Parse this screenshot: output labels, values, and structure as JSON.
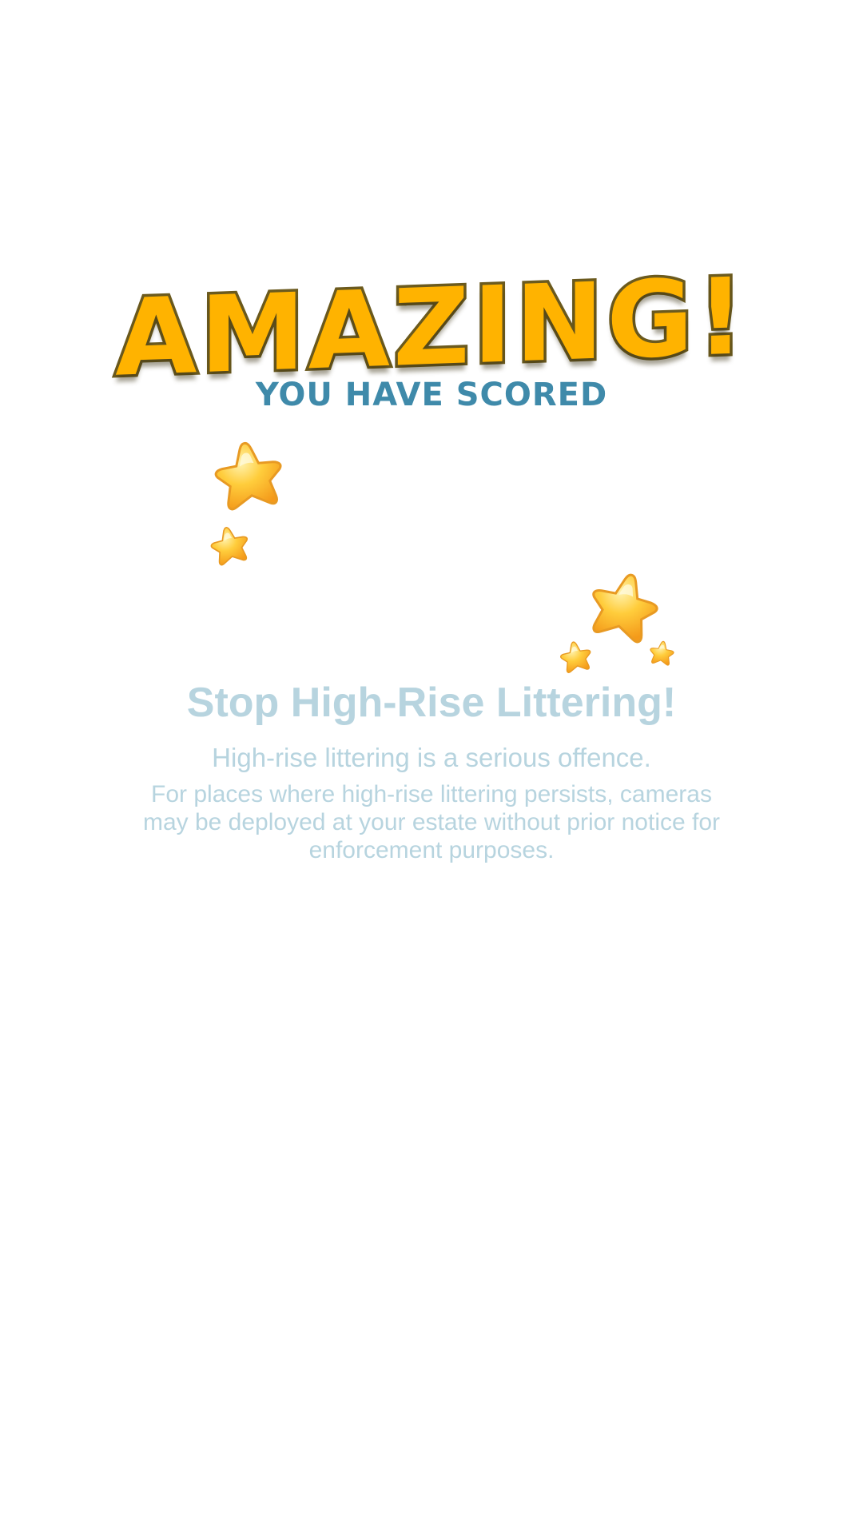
{
  "result": {
    "title": "AMAZING!",
    "subtitle": "YOU HAVE SCORED"
  },
  "message": {
    "headline": "Stop High-Rise Littering!",
    "subline": "High-rise littering is a serious offence.",
    "body": "For places where high-rise littering persists, cameras may be deployed at your estate without prior notice for enforcement purposes."
  },
  "icons": {
    "star": "star-icon"
  },
  "colors": {
    "title_fill": "#ffb300",
    "title_outline": "#6b5a1e",
    "subtitle": "#3f8aaa",
    "message_text": "#b7d4df",
    "star_fill": "#ffc83a"
  }
}
